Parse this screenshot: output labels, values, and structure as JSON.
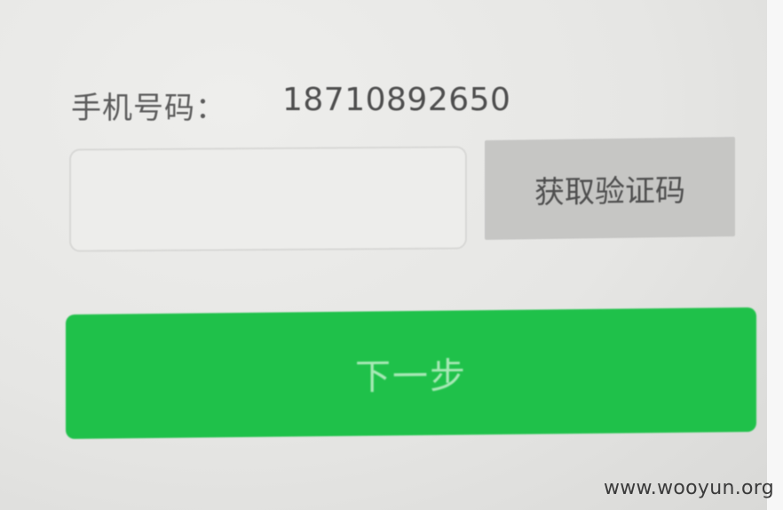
{
  "form": {
    "phone_label": "手机号码：",
    "phone_number": "18710892650",
    "code_input_value": "",
    "get_code_label": "获取验证码",
    "next_label": "下一步"
  },
  "watermark": {
    "text": "www.wooyun.org"
  },
  "colors": {
    "primary_green": "#1fc14a",
    "button_gray": "#c6c6c4",
    "background": "#e6e6e4"
  }
}
